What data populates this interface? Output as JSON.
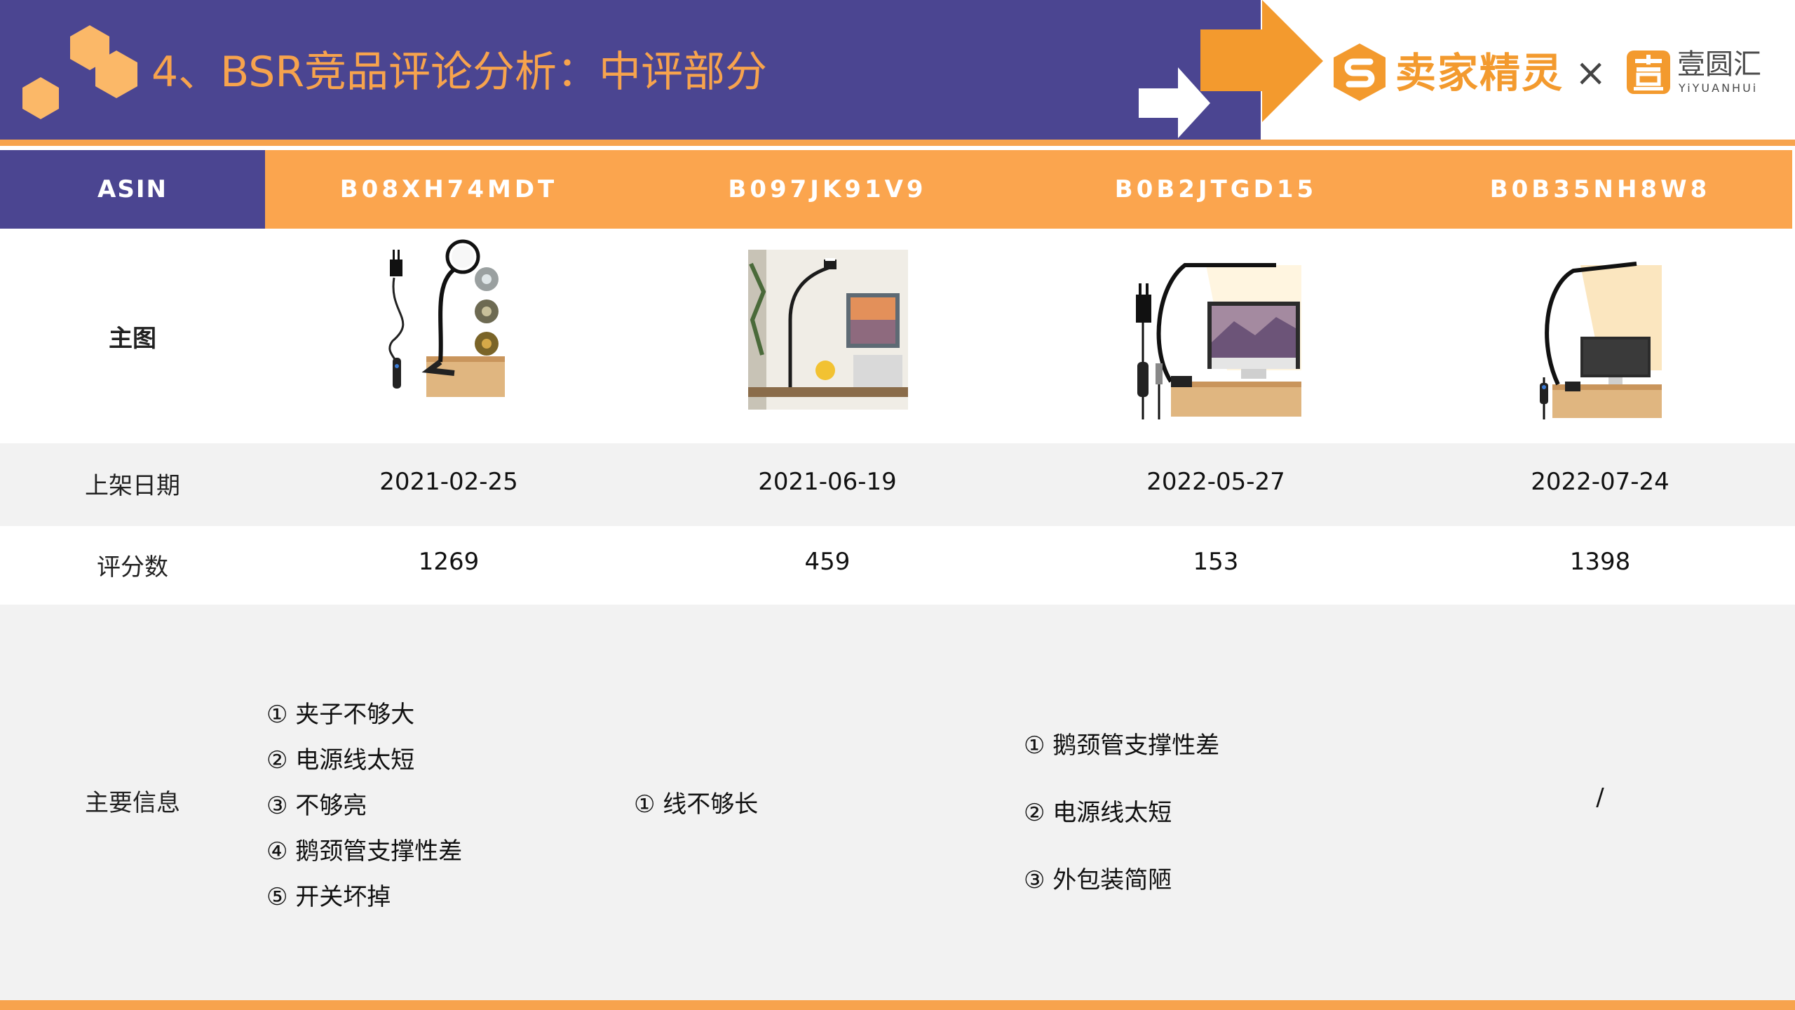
{
  "title": "4、BSR竞品评论分析：中评部分",
  "logos": {
    "seller_sprite": "卖家精灵",
    "separator": "×",
    "yiyuanhui_cn": "壹圆汇",
    "yiyuanhui_en": "YiYUANHUi"
  },
  "colors": {
    "header_purple": "#4b4591",
    "accent_orange": "#f7a34d",
    "table_head_orange": "#fba54e",
    "row_gray": "#f2f2f2"
  },
  "table": {
    "header": {
      "label": "ASIN",
      "asins": [
        "B08XH74MDT",
        "B097JK91V9",
        "B0B2JTGD15",
        "B0B35NH8W8"
      ]
    },
    "rows": {
      "main_image": {
        "label": "主图"
      },
      "listing_date": {
        "label": "上架日期",
        "values": [
          "2021-02-25",
          "2021-06-19",
          "2022-05-27",
          "2022-07-24"
        ]
      },
      "rating_count": {
        "label": "评分数",
        "values": [
          "1269",
          "459",
          "153",
          "1398"
        ]
      },
      "main_info": {
        "label": "主要信息",
        "col1": [
          "① 夹子不够大",
          "② 电源线太短",
          "③ 不够亮",
          "④ 鹅颈管支撑性差",
          "⑤ 开关坏掉"
        ],
        "col2": [
          "① 线不够长"
        ],
        "col3": [
          "① 鹅颈管支撑性差",
          "② 电源线太短",
          "③ 外包装简陋"
        ],
        "col4": [
          "/"
        ]
      }
    }
  }
}
